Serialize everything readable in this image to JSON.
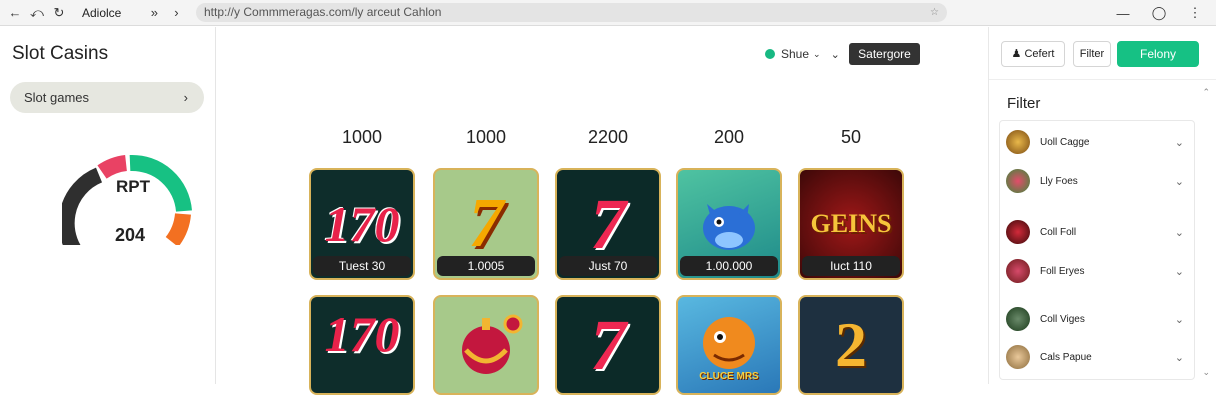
{
  "browser": {
    "tab_title": "Adiolce",
    "url": "http://y Commmeragas.com/ly arceut Cahlon",
    "nav_icons": [
      "back-icon",
      "forward-icon",
      "reload-icon"
    ],
    "right_icons": [
      "minimize-icon",
      "info-icon",
      "more-icon"
    ]
  },
  "sidebar": {
    "title": "Slot Casins",
    "category_pill": "Slot games",
    "rtp_label": "RPT",
    "rtp_value": "204"
  },
  "toolbar": {
    "shoe_label": "Shue",
    "category_button": "Satergore"
  },
  "games": {
    "values": [
      "1000",
      "1000",
      "2200",
      "200",
      "50"
    ],
    "row1": [
      {
        "art_text": "170",
        "caption": "Tuest 30"
      },
      {
        "art_text": "7",
        "caption": "1.0005"
      },
      {
        "art_text": "7",
        "caption": "Just 70"
      },
      {
        "art_text": "",
        "caption": "1.00.000"
      },
      {
        "art_text": "GEINS",
        "caption": "Iuct 110"
      }
    ],
    "row2": [
      {
        "art_text": "170"
      },
      {
        "art_text": ""
      },
      {
        "art_text": "7"
      },
      {
        "art_text": "CLUCE MRS"
      },
      {
        "art_text": "2"
      }
    ]
  },
  "right_panel": {
    "buttons": {
      "primary_left": "Cefert",
      "filter": "Filter",
      "cta": "Felony"
    },
    "filter_title": "Filter",
    "items": [
      {
        "label": "Uoll Cagge"
      },
      {
        "label": "Lly Foes"
      },
      {
        "label": "Coll Foll"
      },
      {
        "label": "Foll Eryes"
      },
      {
        "label": "Coll Viges"
      },
      {
        "label": "Cals Papue"
      }
    ]
  },
  "colors": {
    "accent_green": "#16c184",
    "dark_button": "#333333",
    "gauge_red": "#e94264",
    "gauge_green": "#17c183",
    "gauge_orange": "#f37021",
    "gauge_dark": "#2f2f2f"
  }
}
